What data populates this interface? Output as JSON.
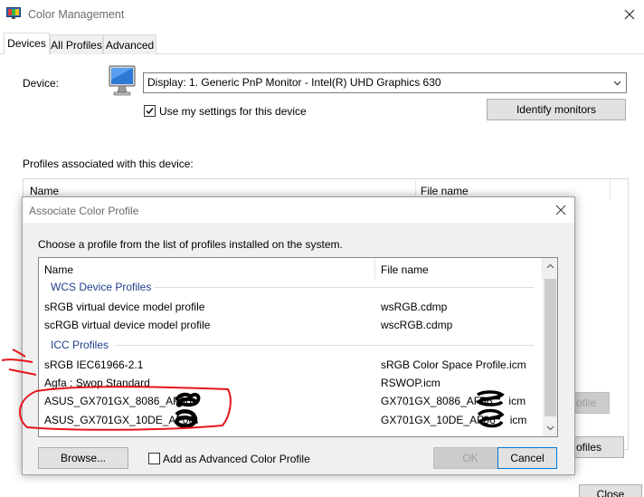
{
  "window": {
    "title": "Color Management",
    "tabs": [
      "Devices",
      "All Profiles",
      "Advanced"
    ]
  },
  "devices": {
    "device_label": "Device:",
    "device_value": "Display: 1. Generic PnP Monitor - Intel(R) UHD Graphics 630",
    "use_settings_label": "Use my settings for this device",
    "use_settings_checked": true,
    "identify_label": "Identify monitors",
    "profiles_label": "Profiles associated with this device:",
    "columns": [
      "Name",
      "File name"
    ],
    "bg_button_partial": "ofile",
    "bg_button_partial2": "ofiles",
    "bottom_button_partial": "Close"
  },
  "dialog": {
    "title": "Associate Color Profile",
    "instruction": "Choose a profile from the list of profiles installed on the system.",
    "columns": [
      "Name",
      "File name"
    ],
    "groups": [
      {
        "name": "WCS Device Profiles",
        "rows": [
          {
            "name": "sRGB virtual device model profile",
            "file": "wsRGB.cdmp"
          },
          {
            "name": "scRGB virtual device model profile",
            "file": "wscRGB.cdmp"
          }
        ]
      },
      {
        "name": "ICC Profiles",
        "rows": [
          {
            "name": "sRGB IEC61966-2.1",
            "file": "sRGB Color Space Profile.icm"
          },
          {
            "name": "Agfa : Swop Standard",
            "file": "RSWOP.icm"
          },
          {
            "name": "ASUS_GX701GX_8086_AF06",
            "file": "GX701GX_8086_AF06",
            "file_suffix": "icm"
          },
          {
            "name": "ASUS_GX701GX_10DE_AF06",
            "file": "GX701GX_10DE_AF06",
            "file_suffix": "icm"
          }
        ]
      }
    ],
    "browse_label": "Browse...",
    "advanced_label": "Add as Advanced Color Profile",
    "advanced_checked": false,
    "ok_label": "OK",
    "cancel_label": "Cancel"
  },
  "colors": {
    "accent": "#0078d7",
    "group_text": "#1e3e8c",
    "annotation": "#e8141c",
    "redaction": "#000000"
  }
}
